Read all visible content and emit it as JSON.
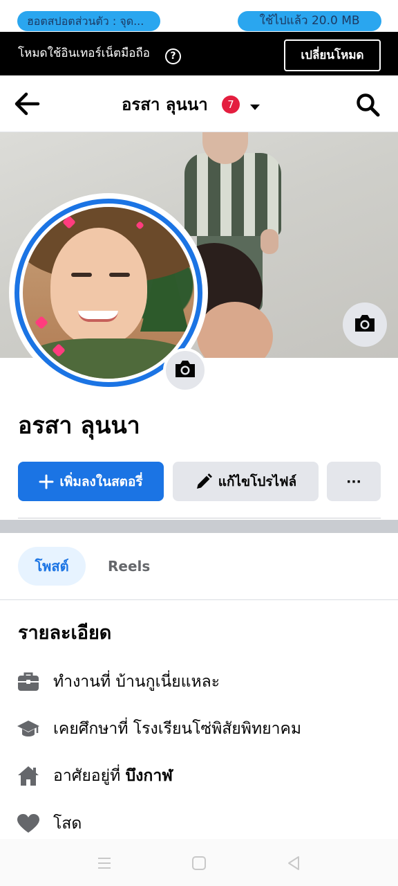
{
  "status": {
    "hotspot_label": "ฮอตสปอตส่วนตัว : จุด...",
    "data_used_label": "ใช้ไปแล้ว 20.0 MB"
  },
  "data_banner": {
    "text": "โหมดใช้อินเทอร์เน็ตมือถือ",
    "help_icon": "?",
    "switch_label": "เปลี่ยนโหมด"
  },
  "nav": {
    "title": "อรสา ลุนนา",
    "notification_count": "7"
  },
  "profile": {
    "name": "อรสา ลุนนา",
    "add_story_label": "เพิ่มลงในสตอรี่",
    "edit_profile_label": "แก้ไขโปรไฟล์",
    "more_label": "···"
  },
  "tabs": [
    {
      "label": "โพสต์",
      "selected": true
    },
    {
      "label": "Reels",
      "selected": false
    }
  ],
  "details": {
    "title": "รายละเอียด",
    "work": "ทำงานที่ บ้านกูเนี่ยแหละ",
    "education": "เคยศึกษาที่ โรงเรียนโซ่พิสัยพิทยาคม",
    "lives_prefix": "อาศัยอยู่ที่ ",
    "lives_place": "บึงกาฬ",
    "relationship": "โสด"
  },
  "colors": {
    "accent": "#1b74e4",
    "badge": "#e41e3f",
    "pill": "#2aa6ef"
  },
  "icons": [
    "back-arrow-icon",
    "dropdown-caret-icon",
    "search-icon",
    "camera-icon",
    "plus-icon",
    "pencil-icon",
    "briefcase-icon",
    "graduation-cap-icon",
    "home-icon",
    "heart-icon"
  ]
}
